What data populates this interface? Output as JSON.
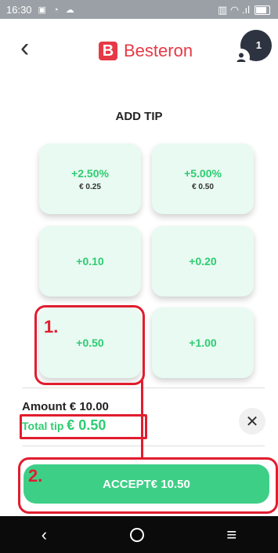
{
  "status_bar": {
    "time": "16:30",
    "left_icons": "▣ ◔ ☁",
    "right_icons": "▥ ◠ .ıl"
  },
  "header": {
    "back_icon": "‹",
    "brand": "Besteron",
    "brand_mark": "B",
    "notification_count": "1"
  },
  "title": "ADD TIP",
  "tips": [
    {
      "label": "+2.50%",
      "sub": "€ 0.25"
    },
    {
      "label": "+5.00%",
      "sub": "€ 0.50"
    },
    {
      "label": "+0.10",
      "sub": ""
    },
    {
      "label": "+0.20",
      "sub": ""
    },
    {
      "label": "+0.50",
      "sub": ""
    },
    {
      "label": "+1.00",
      "sub": ""
    }
  ],
  "summary": {
    "amount_label": "Amount",
    "amount_value": "€ 10.00",
    "total_tip_label": "Total tip",
    "total_tip_value": "€ 0.50"
  },
  "accept": {
    "label": "ACCEPT€ 10.50"
  },
  "annotations": {
    "step1": "1.",
    "step2": "2."
  },
  "nav": {
    "back": "‹",
    "menu": "≡"
  },
  "colors": {
    "brand_red": "#e63946",
    "accent_green": "#3ecf87",
    "annotation_red": "#e11d2e"
  }
}
